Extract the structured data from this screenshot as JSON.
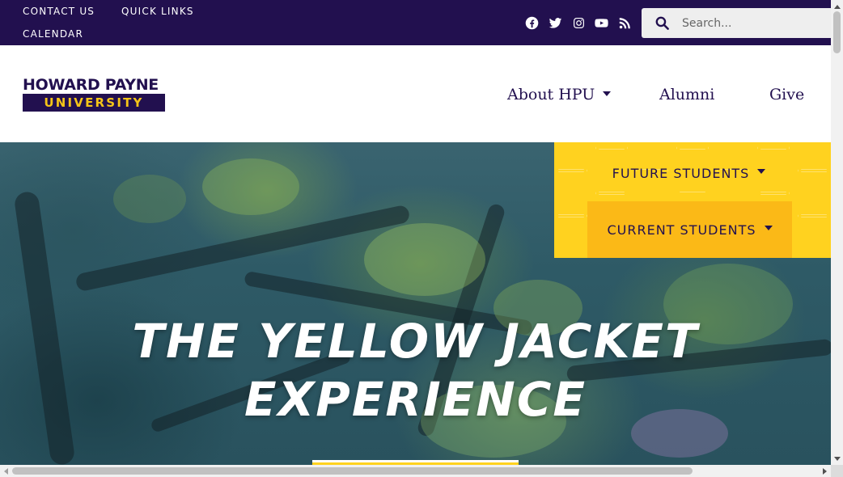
{
  "topbar": {
    "links": [
      {
        "label": "CONTACT US"
      },
      {
        "label": "QUICK LINKS"
      },
      {
        "label": "CALENDAR"
      }
    ],
    "social_icons": [
      "facebook-icon",
      "twitter-icon",
      "instagram-icon",
      "youtube-icon",
      "rss-icon"
    ],
    "search": {
      "placeholder": "Search...",
      "value": ""
    }
  },
  "header": {
    "logo": {
      "line1": "HOWARD PAYNE",
      "line2": "UNIVERSITY"
    },
    "nav": [
      {
        "label": "About HPU",
        "has_dropdown": true
      },
      {
        "label": "Alumni",
        "has_dropdown": false
      },
      {
        "label": "Give",
        "has_dropdown": false
      }
    ]
  },
  "student_menu": {
    "items": [
      {
        "label": "FUTURE STUDENTS",
        "has_dropdown": true
      },
      {
        "label": "CURRENT STUDENTS",
        "has_dropdown": true
      }
    ]
  },
  "hero": {
    "title_line1": "THE YELLOW JACKET",
    "title_line2": "EXPERIENCE"
  },
  "colors": {
    "brand_purple": "#22104f",
    "brand_gold": "#ffd21f",
    "accent_orange": "#fbb917"
  }
}
